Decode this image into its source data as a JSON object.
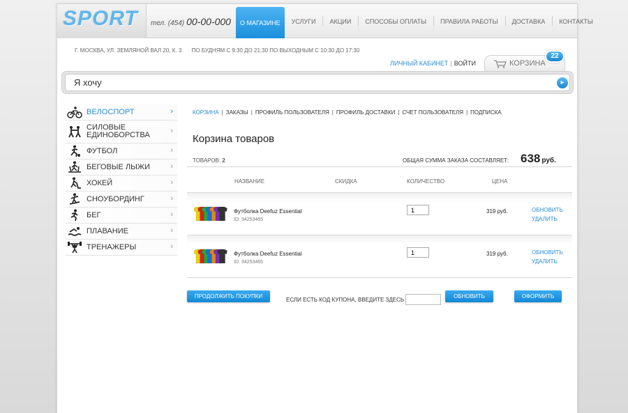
{
  "header": {
    "logo": "SPORT",
    "phone_label": "тел. (454)",
    "phone_number": "00-00-000",
    "nav": [
      "О МАГАЗИНЕ",
      "УСЛУГИ",
      "АКЦИИ",
      "СПОСОБЫ ОПЛАТЫ",
      "ПРАВИЛА РАБОТЫ",
      "ДОСТАВКА",
      "КОНТАКТЫ"
    ],
    "active_nav": "О МАГАЗИНЕ",
    "address": "Г. МОСКВА, УЛ. ЗЕМЛЯНОЙ ВАЛ 20, К. 3",
    "hours": "ПО БУДНЯМ С 9:30 ДО 21:30 ПО ВЫХОДНЫМ С 10:30 ДО 17:30",
    "account_link": "ЛИЧНЫЙ КАБИНЕТ",
    "separator": "|",
    "login_link": "ВОЙТИ",
    "cart_label": "КОРЗИНА",
    "cart_count": "22"
  },
  "search": {
    "value": "Я хочу",
    "button_icon": "arrow-right-icon"
  },
  "sidebar": {
    "items": [
      {
        "label": "ВЕЛОСПОРТ",
        "icon": "cycling-icon",
        "active": true
      },
      {
        "label": "СИЛОВЫЕ ЕДИНОБОРСТВА",
        "icon": "wrestling-icon"
      },
      {
        "label": "ФУТБОЛ",
        "icon": "football-icon"
      },
      {
        "label": "БЕГОВЫЕ ЛЫЖИ",
        "icon": "skiing-icon"
      },
      {
        "label": "ХОКЕЙ",
        "icon": "hockey-icon"
      },
      {
        "label": "СНОУБОРДИНГ",
        "icon": "snowboarding-icon"
      },
      {
        "label": "БЕГ",
        "icon": "running-icon"
      },
      {
        "label": "ПЛАВАНИЕ",
        "icon": "swimming-icon"
      },
      {
        "label": "ТРЕНАЖЕРЫ",
        "icon": "weightlifting-icon"
      }
    ],
    "arrow": "›"
  },
  "breadcrumbs": [
    "КОРЗИНА",
    "ЗАКАЗЫ",
    "ПРОФИЛЬ ПОЛЬЗОВАТЕЛЯ",
    "ПРОФИЛЬ ДОСТАВКИ",
    "СЧЕТ ПОЛЬЗОВАТЕЛЯ",
    "ПОДПИСКА"
  ],
  "page_title": "Корзина товаров",
  "summary": {
    "items_label": "ТОВАРОВ:",
    "items_count": "2",
    "total_label": "ОБЩАЯ СУММА ЗАКАЗА СОСТАВЛЯЕТ:",
    "total_value": "638",
    "currency": "руб."
  },
  "table": {
    "columns": [
      "НАЗВАНИЕ",
      "СКИДКА",
      "КОЛИЧЕСТВО",
      "ЦЕНА"
    ],
    "rows": [
      {
        "name": "Футболка Deefuz Essential",
        "id": "ID: 34253465",
        "quantity": "1",
        "price": "319 руб.",
        "update": "ОБНОВИТЬ",
        "delete": "УДАЛИТЬ"
      },
      {
        "name": "Футболка Deefuz Essential",
        "id": "ID: 34253465",
        "quantity": "1",
        "price": "319 руб.",
        "update": "ОБНОВИТЬ",
        "delete": "УДАЛИТЬ"
      }
    ],
    "tshirt_colors": [
      "#e8d200",
      "#d42020",
      "#27a83a",
      "#1b6ed6",
      "#e08a10",
      "#7a2eb8",
      "#333333"
    ]
  },
  "footer": {
    "continue_label": "ПРОДОЛЖИТЬ ПОКУПКИ",
    "coupon_label": "ЕСЛИ ЕСТЬ КОД КУПОНА, ВВЕДИТЕ ЗДЕСЬ",
    "coupon_value": "",
    "update_label": "ОБНОВИТЬ",
    "checkout_label": "ОФОРМИТЬ"
  },
  "colors": {
    "accent": "#2a8bd6",
    "button": "#1b8ed8"
  }
}
